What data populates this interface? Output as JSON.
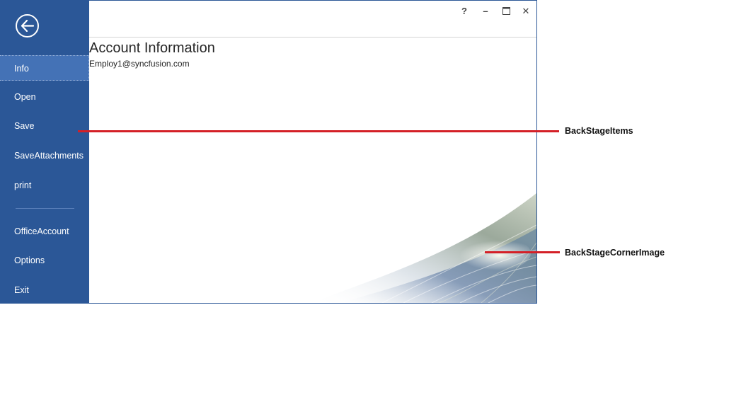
{
  "window": {
    "help_label": "?",
    "minimize_label": "–",
    "close_label": "✕"
  },
  "sidebar": {
    "back_icon": "arrow-left-icon",
    "items": [
      {
        "label": "Info",
        "selected": true
      },
      {
        "label": "Open",
        "selected": false
      },
      {
        "label": "Save",
        "selected": false
      },
      {
        "label": "SaveAttachments",
        "selected": false
      },
      {
        "label": "print",
        "selected": false
      },
      {
        "label": "OfficeAccount",
        "selected": false
      },
      {
        "label": "Options",
        "selected": false
      },
      {
        "label": "Exit",
        "selected": false
      }
    ]
  },
  "content": {
    "title": "Account Information",
    "email": "Employ1@syncfusion.com"
  },
  "annotations": {
    "items_label": "BackStageItems",
    "corner_image_label": "BackStageCornerImage"
  },
  "colors": {
    "sidebar": "#2b5797",
    "selected_item": "#4472b6",
    "annotation_line": "#d42027"
  }
}
